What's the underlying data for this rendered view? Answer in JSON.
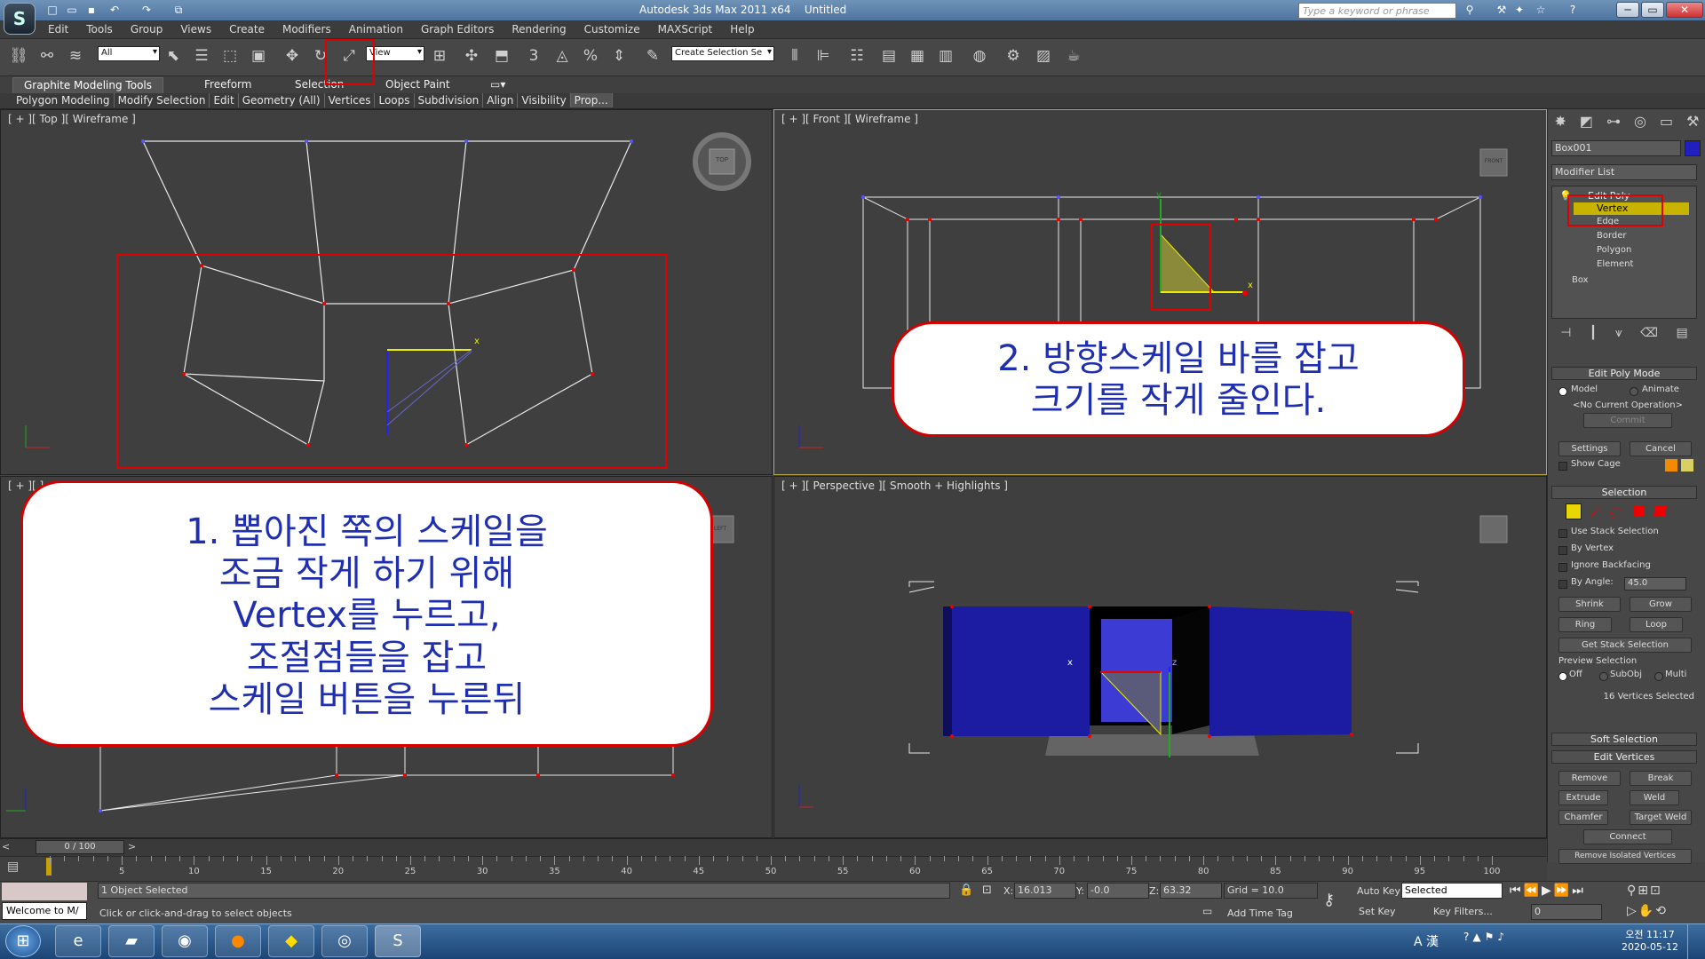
{
  "title": {
    "app": "Autodesk 3ds Max  2011 x64",
    "doc": "Untitled",
    "search_placeholder": "Type a keyword or phrase"
  },
  "menu": [
    "Edit",
    "Tools",
    "Group",
    "Views",
    "Create",
    "Modifiers",
    "Animation",
    "Graph Editors",
    "Rendering",
    "Customize",
    "MAXScript",
    "Help"
  ],
  "toolbar": {
    "filter_value": "All",
    "refcoord_value": "View",
    "named_sel_value": "Create Selection Se"
  },
  "ribbon": {
    "tabs": [
      "Graphite Modeling Tools",
      "Freeform",
      "Selection",
      "Object Paint"
    ],
    "panels": [
      "Polygon Modeling",
      "Modify Selection",
      "Edit",
      "Geometry (All)",
      "Vertices",
      "Loops",
      "Subdivision",
      "Align",
      "Visibility",
      "Prop..."
    ]
  },
  "viewports": {
    "top": "[ + ][ Top ][ Wireframe ]",
    "front": "[ + ][ Front ][ Wireframe ]",
    "left": "[ + ][ ]",
    "persp": "[ + ][ Perspective ][ Smooth + Highlights ]",
    "viewcube_top": "TOP",
    "viewcube_front": "FRONT",
    "viewcube_left": "LEFT"
  },
  "callouts": {
    "step2": [
      "2. 방향스케일 바를 잡고",
      "크기를 작게 줄인다."
    ],
    "step1": [
      "1. 뽑아진 쪽의 스케일을",
      "조금 작게 하기 위해",
      "Vertex를 누르고,",
      "조절점들을 잡고",
      "스케일 버튼을 누른뒤"
    ]
  },
  "panel": {
    "object_name": "Box001",
    "modifier_list": "Modifier List",
    "stack": [
      "Edit Poly",
      "Vertex",
      "Edge",
      "Border",
      "Polygon",
      "Element",
      "Box"
    ],
    "edit_poly_mode": {
      "header": "Edit Poly Mode",
      "model": "Model",
      "animate": "Animate",
      "current_op": "<No Current Operation>",
      "commit": "Commit",
      "settings": "Settings",
      "cancel": "Cancel",
      "show_cage": "Show Cage"
    },
    "selection": {
      "header": "Selection",
      "use_stack": "Use Stack Selection",
      "by_vertex": "By Vertex",
      "ignore_backfacing": "Ignore Backfacing",
      "by_angle": "By Angle:",
      "angle_value": "45.0",
      "shrink": "Shrink",
      "grow": "Grow",
      "ring": "Ring",
      "loop": "Loop",
      "get_stack": "Get Stack Selection",
      "preview": "Preview Selection",
      "off": "Off",
      "subobj": "SubObj",
      "multi": "Multi",
      "count": "16 Vertices Selected"
    },
    "soft_selection": "Soft Selection",
    "edit_vertices": {
      "header": "Edit Vertices",
      "remove": "Remove",
      "break": "Break",
      "extrude": "Extrude",
      "weld": "Weld",
      "chamfer": "Chamfer",
      "target_weld": "Target Weld",
      "connect": "Connect",
      "remove_isolated": "Remove Isolated Vertices"
    }
  },
  "timeline": {
    "frame": "0 / 100",
    "ticks": [
      "5",
      "10",
      "15",
      "20",
      "25",
      "30",
      "35",
      "40",
      "45",
      "50",
      "55",
      "60",
      "65",
      "70",
      "75",
      "80",
      "85",
      "90",
      "95",
      "100"
    ]
  },
  "status": {
    "welcome": "Welcome to M/",
    "selected": "1 Object Selected",
    "prompt": "Click or click-and-drag to select objects",
    "x_label": "X:",
    "x": "16.013",
    "y_label": "Y:",
    "y": "-0.0",
    "z_label": "Z:",
    "z": "63.32",
    "grid": "Grid = 10.0",
    "add_time_tag": "Add Time Tag",
    "auto_key": "Auto Key",
    "set_key": "Set Key",
    "selected_dd": "Selected",
    "key_filters": "Key Filters...",
    "frame_field": "0"
  },
  "taskbar": {
    "time": "오전 11:17",
    "date": "2020-05-12",
    "ime": "A 漢"
  }
}
